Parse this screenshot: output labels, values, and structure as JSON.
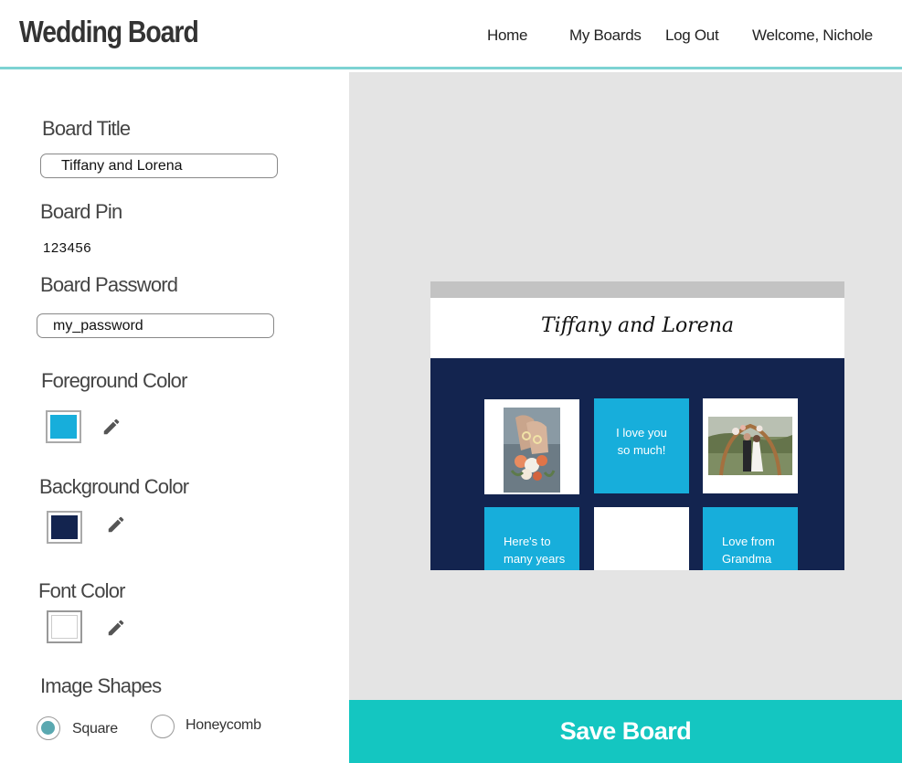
{
  "app": {
    "title": "Wedding Board"
  },
  "nav": {
    "home": "Home",
    "my_boards": "My Boards",
    "log_out": "Log Out",
    "welcome": "Welcome, Nichole"
  },
  "form": {
    "board_title_label": "Board Title",
    "board_title_value": "Tiffany and Lorena",
    "board_pin_label": "Board Pin",
    "board_pin_value": "123456",
    "board_password_label": "Board Password",
    "board_password_value": "my_password",
    "foreground_color_label": "Foreground Color",
    "foreground_color": "#17aedb",
    "background_color_label": "Background Color",
    "background_color": "#13244f",
    "font_color_label": "Font Color",
    "font_color": "#ffffff",
    "image_shapes_label": "Image Shapes",
    "shape_options": [
      "Square",
      "Honeycomb"
    ],
    "selected_shape": "Square"
  },
  "preview": {
    "title": "Tiffany and Lorena",
    "tiles": [
      {
        "type": "photo",
        "icon": "wedding-rings-photo"
      },
      {
        "type": "note",
        "lines": [
          "I love you",
          "so much!"
        ]
      },
      {
        "type": "photo",
        "icon": "wedding-couple-photo"
      },
      {
        "type": "note",
        "lines": [
          "Here's to",
          "many years"
        ]
      },
      {
        "type": "blank"
      },
      {
        "type": "note",
        "lines": [
          "Love from",
          "Grandma"
        ]
      }
    ]
  },
  "actions": {
    "save_label": "Save Board"
  },
  "colors": {
    "accent": "#14c6c1",
    "header_border": "#7dd3d3",
    "preview_bg": "#e4e4e4",
    "radio_fill": "#5aa8b0"
  }
}
